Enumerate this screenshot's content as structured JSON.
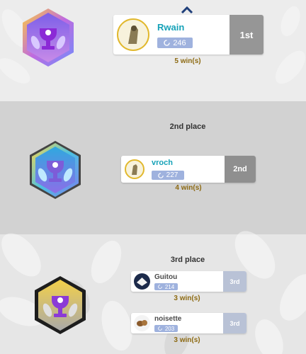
{
  "places": {
    "first": {
      "rank": "1st"
    },
    "second": {
      "title": "2nd place",
      "rank": "2nd"
    },
    "third": {
      "title": "3rd place",
      "rank": "3rd"
    }
  },
  "players": [
    {
      "name": "Rwain",
      "score": "246",
      "wins": "5 win(s)"
    },
    {
      "name": "vroch",
      "score": "227",
      "wins": "4 win(s)"
    },
    {
      "name": "Guitou",
      "score": "214",
      "wins": "3 win(s)"
    },
    {
      "name": "noisette",
      "score": "203",
      "wins": "3 win(s)"
    }
  ],
  "colors": {
    "name": "#16a2b8",
    "score_bg": "#9fb2de",
    "wins": "#8d6a12",
    "rank_first": "#969696",
    "rank_second": "#8f8f8f",
    "rank_third": "#b9c2d6"
  },
  "icons": [
    "chevron-up-icon",
    "trophy-icon",
    "laurel-icon",
    "spinner-icon"
  ]
}
